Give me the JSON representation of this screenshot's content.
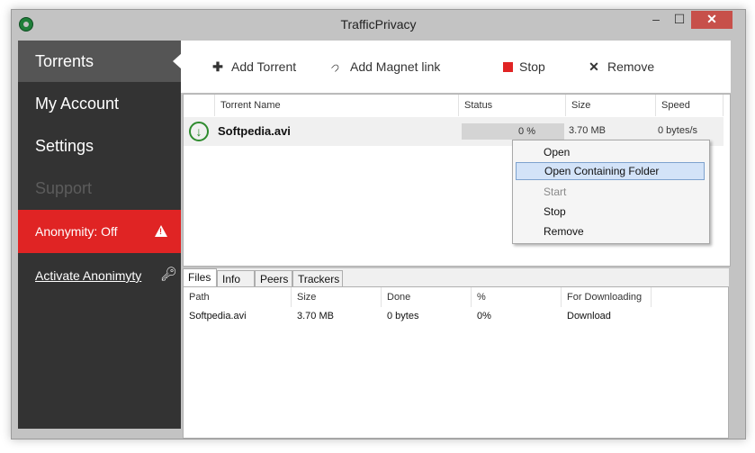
{
  "window": {
    "title": "TrafficPrivacy",
    "minimize_glyph": "–",
    "maximize_glyph": "☐",
    "close_glyph": "✕"
  },
  "sidebar": {
    "items": [
      {
        "label": "Torrents",
        "state": "active"
      },
      {
        "label": "My Account",
        "state": "normal"
      },
      {
        "label": "Settings",
        "state": "normal"
      },
      {
        "label": "Support",
        "state": "disabled"
      }
    ],
    "anonymity_label": "Anonymity: Off",
    "activate_label": "Activate Anonimyty"
  },
  "toolbar": {
    "add_torrent": "Add Torrent",
    "add_magnet": "Add Magnet link",
    "stop": "Stop",
    "remove": "Remove",
    "icons": {
      "add": "plus-icon",
      "magnet": "magnet-icon",
      "stop": "stop-icon",
      "remove": "x-icon"
    }
  },
  "torrents": {
    "columns": [
      "Torrent Name",
      "Status",
      "Size",
      "Speed"
    ],
    "rows": [
      {
        "name": "Softpedia.avi",
        "status": "0 %",
        "progress_percent": 0,
        "size": "3.70 MB",
        "speed": "0 bytes/s"
      }
    ]
  },
  "context_menu": {
    "items": [
      {
        "label": "Open",
        "state": "normal"
      },
      {
        "label": "Open Containing Folder",
        "state": "highlighted"
      },
      {
        "label": "Start",
        "state": "disabled"
      },
      {
        "label": "Stop",
        "state": "normal"
      },
      {
        "label": "Remove",
        "state": "normal"
      }
    ]
  },
  "details": {
    "tabs": [
      "Files",
      "Info",
      "Peers",
      "Trackers"
    ],
    "active_tab": "Files",
    "columns": [
      "Path",
      "Size",
      "Done",
      "%",
      "For Downloading"
    ],
    "rows": [
      [
        "Softpedia.avi",
        "3.70 MB",
        "0 bytes",
        "0%",
        "Download"
      ]
    ]
  },
  "colors": {
    "accent_red": "#e02424",
    "sidebar_bg": "#333333",
    "active_nav": "#555555",
    "download_green": "#2e8b2e"
  }
}
